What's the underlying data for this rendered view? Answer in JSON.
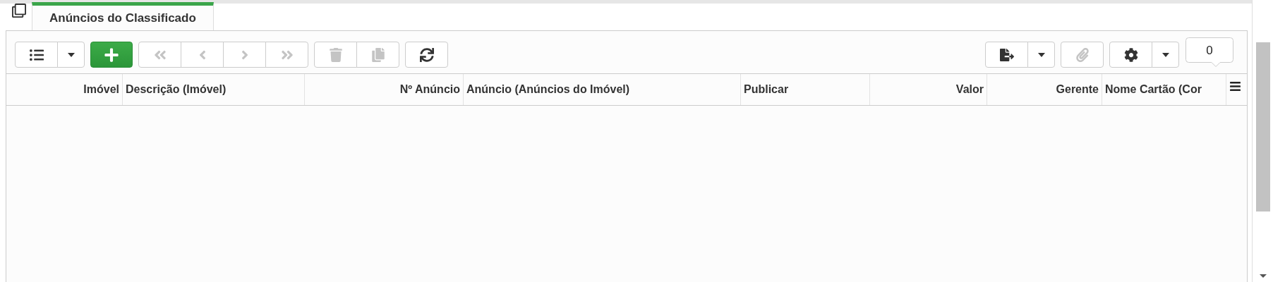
{
  "tabs": [
    {
      "label": "Anúncios do Classificado",
      "selected": true
    }
  ],
  "toolbar_left": [
    [
      {
        "kind": "list",
        "disabled": false
      },
      {
        "kind": "dropdown",
        "disabled": false
      }
    ],
    [
      {
        "kind": "add",
        "disabled": false
      }
    ],
    [
      {
        "kind": "first",
        "disabled": true
      },
      {
        "kind": "previous",
        "disabled": true
      },
      {
        "kind": "next",
        "disabled": true
      },
      {
        "kind": "last",
        "disabled": true
      }
    ],
    [
      {
        "kind": "delete",
        "disabled": true
      },
      {
        "kind": "copy",
        "disabled": true
      }
    ],
    [
      {
        "kind": "refresh",
        "disabled": false
      }
    ]
  ],
  "toolbar_right": [
    [
      {
        "kind": "export",
        "disabled": false
      },
      {
        "kind": "dropdown",
        "disabled": false
      }
    ],
    [
      {
        "kind": "attach",
        "disabled": true
      }
    ],
    [
      {
        "kind": "settings",
        "disabled": false
      },
      {
        "kind": "dropdown",
        "disabled": false
      }
    ]
  ],
  "record_count": "0",
  "table": {
    "columns": [
      "Imóvel",
      "Descrição (Imóvel)",
      "Nº Anúncio",
      "Anúncio (Anúncios do Imóvel)",
      "Publicar",
      "Valor",
      "Gerente",
      "Nome Cartão (Cor"
    ]
  }
}
